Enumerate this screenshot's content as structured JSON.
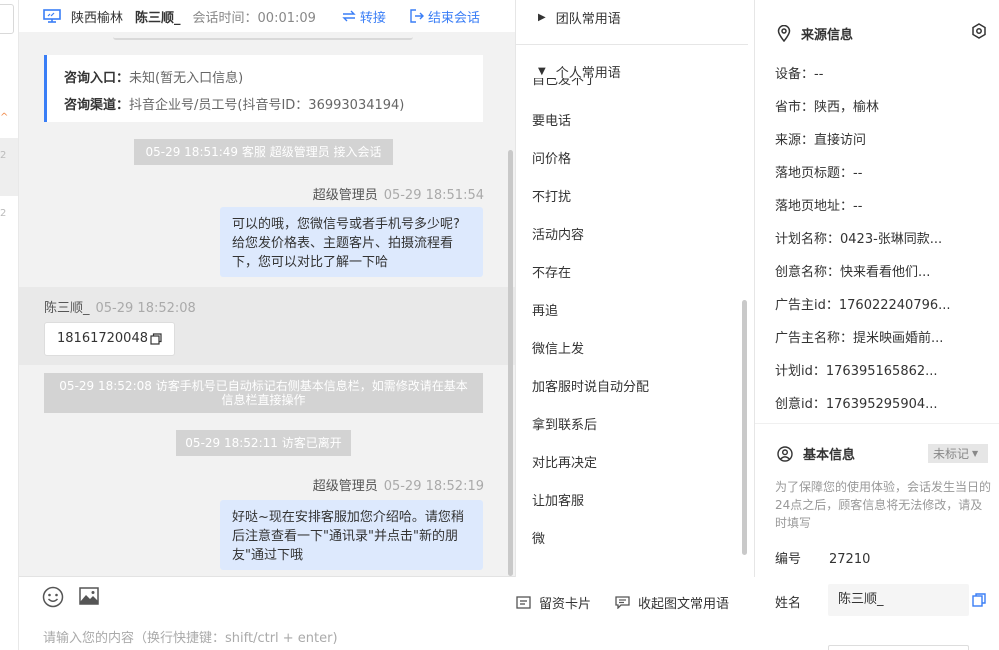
{
  "header": {
    "location": "陕西榆林",
    "visitor_name": "陈三顺_",
    "session_time": "会话时间：00:01:09",
    "transfer_label": "转接",
    "end_label": "结束会话"
  },
  "left_strip": {
    "num1": "2",
    "num2": "2"
  },
  "info_card": {
    "entry_label": "咨询入口：",
    "entry_value": "未知(暂无入口信息)",
    "channel_label": "咨询渠道：",
    "channel_value": "抖音企业号/员工号(抖音号ID：36993034194)"
  },
  "messages": {
    "sys1": "05-29 18:51:49 客服 超级管理员 接入会话",
    "agent1_name": "超级管理员",
    "agent1_time": "05-29 18:51:54",
    "agent1_text": "可以的哦，您微信号或者手机号多少呢?给您发价格表、主题客片、拍摄流程看下，您可以对比了解一下哈",
    "visitor_name": "陈三顺_",
    "visitor_time": "05-29 18:52:08",
    "visitor_phone": "18161720048",
    "sys2": "05-29 18:52:08 访客手机号已自动标记右侧基本信息栏，如需修改请在基本信息栏直接操作",
    "sys3": "05-29 18:52:11 访客已离开",
    "agent2_name": "超级管理员",
    "agent2_time": "05-29 18:52:19",
    "agent2_text": "好哒~现在安排客服加您介绍哈。请您稍后注意查看一下\"通讯录\"并点击\"新的朋友\"通过下哦"
  },
  "input": {
    "card_label": "留资卡片",
    "collapse_label": "收起图文常用语",
    "placeholder": "请输入您的内容（换行快捷键：shift/ctrl + enter)"
  },
  "phrases": {
    "team_label": "团队常用语",
    "personal_label": "个人常用语",
    "cutoff_text": "自己发不了",
    "items": [
      "要电话",
      "问价格",
      "不打扰",
      "活动内容",
      "不存在",
      "再追",
      "微信上发",
      "加客服时说自动分配",
      "拿到联系后",
      "对比再决定",
      "让加客服",
      "微"
    ]
  },
  "source_info": {
    "title": "来源信息",
    "fields": [
      {
        "label": "设备：",
        "value": "--"
      },
      {
        "label": "省市：",
        "value": "陕西，榆林"
      },
      {
        "label": "来源：",
        "value": "直接访问"
      },
      {
        "label": "落地页标题：",
        "value": "--"
      },
      {
        "label": "落地页地址：",
        "value": "--"
      },
      {
        "label": "计划名称：",
        "value": "0423-张琳同款..."
      },
      {
        "label": "创意名称：",
        "value": "快来看看他们..."
      },
      {
        "label": "广告主id：",
        "value": "176022240796..."
      },
      {
        "label": "广告主名称：",
        "value": "提米映画婚前..."
      },
      {
        "label": "计划id：",
        "value": "176395165862..."
      },
      {
        "label": "创意id：",
        "value": "176395295904..."
      }
    ]
  },
  "basic_info": {
    "title": "基本信息",
    "tag": "未标记",
    "notice": "为了保障您的使用体验，会话发生当日的24点之后，顾客信息将无法修改，请及时填写",
    "id_label": "编号",
    "id_value": "27210",
    "name_label": "姓名",
    "name_value": "陈三顺_"
  },
  "colors": {
    "accent": "#3a7ef6",
    "bubble": "#dde9fd",
    "system": "#d3d3d3"
  }
}
